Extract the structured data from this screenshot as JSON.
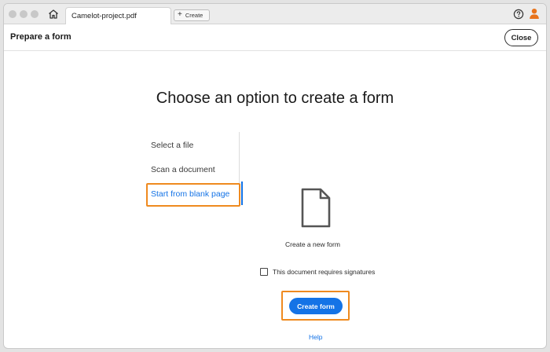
{
  "tabbar": {
    "document_tab": "Camelot-project.pdf",
    "create_tab": "Create",
    "icons": [
      "home-icon",
      "plus-icon",
      "help-icon",
      "account-icon"
    ]
  },
  "header": {
    "title": "Prepare a form",
    "close_label": "Close"
  },
  "main": {
    "heading": "Choose an option to create a form",
    "options": [
      {
        "label": "Select a file",
        "selected": false
      },
      {
        "label": "Scan a document",
        "selected": false
      },
      {
        "label": "Start from blank page",
        "selected": true
      }
    ],
    "panel_icon": "blank-document-icon",
    "create_new_label": "Create a new form",
    "signature_checkbox": {
      "label": "This document requires signatures",
      "checked": false
    },
    "create_button": "Create form",
    "help_link": "Help"
  },
  "colors": {
    "accent_blue": "#1473e6",
    "highlight_orange": "#ef8a1f",
    "account_orange": "#e8731c"
  }
}
